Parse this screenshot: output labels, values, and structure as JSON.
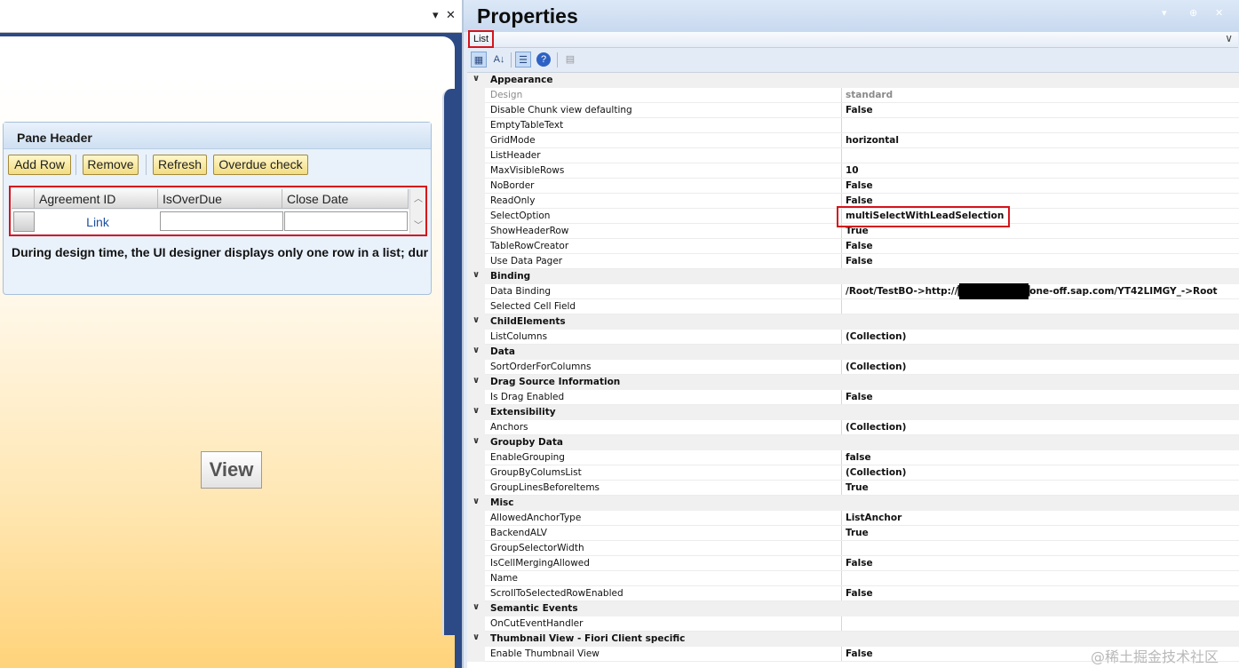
{
  "designer": {
    "top_controls": {
      "dropdown_glyph": "▾",
      "close_glyph": "✕"
    },
    "pane": {
      "header": "Pane Header",
      "buttons": [
        "Add Row",
        "Remove",
        "Refresh",
        "Overdue check"
      ],
      "list": {
        "columns": [
          "Agreement ID",
          "IsOverDue",
          "Close Date"
        ],
        "row_link": "Link"
      },
      "info": "During design time, the UI designer displays only one row in a list; duri"
    },
    "view_label": "View"
  },
  "properties": {
    "title": "Properties",
    "title_icons": [
      "▾",
      "⊕",
      "✕"
    ],
    "object_name": "List",
    "combo_arrow": "∨",
    "toolbar_icons": [
      "categorized-icon",
      "alphabetical-icon",
      "properties-icon",
      "help-icon",
      "property-pages-icon"
    ],
    "rows": [
      {
        "type": "cat",
        "label": "Appearance"
      },
      {
        "type": "prop",
        "label": "Design",
        "value": "standard",
        "dim": true
      },
      {
        "type": "prop",
        "label": "Disable Chunk view defaulting",
        "value": "False"
      },
      {
        "type": "prop",
        "label": "EmptyTableText",
        "value": ""
      },
      {
        "type": "prop",
        "label": "GridMode",
        "value": "horizontal"
      },
      {
        "type": "prop",
        "label": "ListHeader",
        "value": ""
      },
      {
        "type": "prop",
        "label": "MaxVisibleRows",
        "value": "10"
      },
      {
        "type": "prop",
        "label": "NoBorder",
        "value": "False"
      },
      {
        "type": "prop",
        "label": "ReadOnly",
        "value": "False"
      },
      {
        "type": "prop",
        "label": "SelectOption",
        "value": "multiSelectWithLeadSelection"
      },
      {
        "type": "prop",
        "label": "ShowHeaderRow",
        "value": "True"
      },
      {
        "type": "prop",
        "label": "TableRowCreator",
        "value": "False"
      },
      {
        "type": "prop",
        "label": "Use Data Pager",
        "value": "False"
      },
      {
        "type": "cat",
        "label": "Binding"
      },
      {
        "type": "prop",
        "label": "Data Binding",
        "value": "/Root/TestBO->http://██████████one-off.sap.com/YT42LIMGY_->Root"
      },
      {
        "type": "prop",
        "label": "Selected Cell Field",
        "value": ""
      },
      {
        "type": "cat",
        "label": "ChildElements"
      },
      {
        "type": "prop",
        "label": "ListColumns",
        "value": "(Collection)"
      },
      {
        "type": "cat",
        "label": "Data"
      },
      {
        "type": "prop",
        "label": "SortOrderForColumns",
        "value": "(Collection)"
      },
      {
        "type": "cat",
        "label": "Drag Source Information"
      },
      {
        "type": "prop",
        "label": "Is Drag Enabled",
        "value": "False"
      },
      {
        "type": "cat",
        "label": "Extensibility"
      },
      {
        "type": "prop",
        "label": "Anchors",
        "value": "(Collection)"
      },
      {
        "type": "cat",
        "label": "Groupby Data"
      },
      {
        "type": "prop",
        "label": "EnableGrouping",
        "value": "false"
      },
      {
        "type": "prop",
        "label": "GroupByColumsList",
        "value": "(Collection)"
      },
      {
        "type": "prop",
        "label": "GroupLinesBeforeItems",
        "value": "True"
      },
      {
        "type": "cat",
        "label": "Misc"
      },
      {
        "type": "prop",
        "label": "AllowedAnchorType",
        "value": "ListAnchor"
      },
      {
        "type": "prop",
        "label": "BackendALV",
        "value": "True"
      },
      {
        "type": "prop",
        "label": "GroupSelectorWidth",
        "value": ""
      },
      {
        "type": "prop",
        "label": "IsCellMergingAllowed",
        "value": "False"
      },
      {
        "type": "prop",
        "label": "Name",
        "value": ""
      },
      {
        "type": "prop",
        "label": "ScrollToSelectedRowEnabled",
        "value": "False"
      },
      {
        "type": "cat",
        "label": "Semantic Events"
      },
      {
        "type": "prop",
        "label": "OnCutEventHandler",
        "value": ""
      },
      {
        "type": "cat",
        "label": "Thumbnail View - Fiori Client specific"
      },
      {
        "type": "prop",
        "label": "Enable Thumbnail View",
        "value": "False"
      }
    ]
  },
  "watermark": "@稀土掘金技术社区"
}
